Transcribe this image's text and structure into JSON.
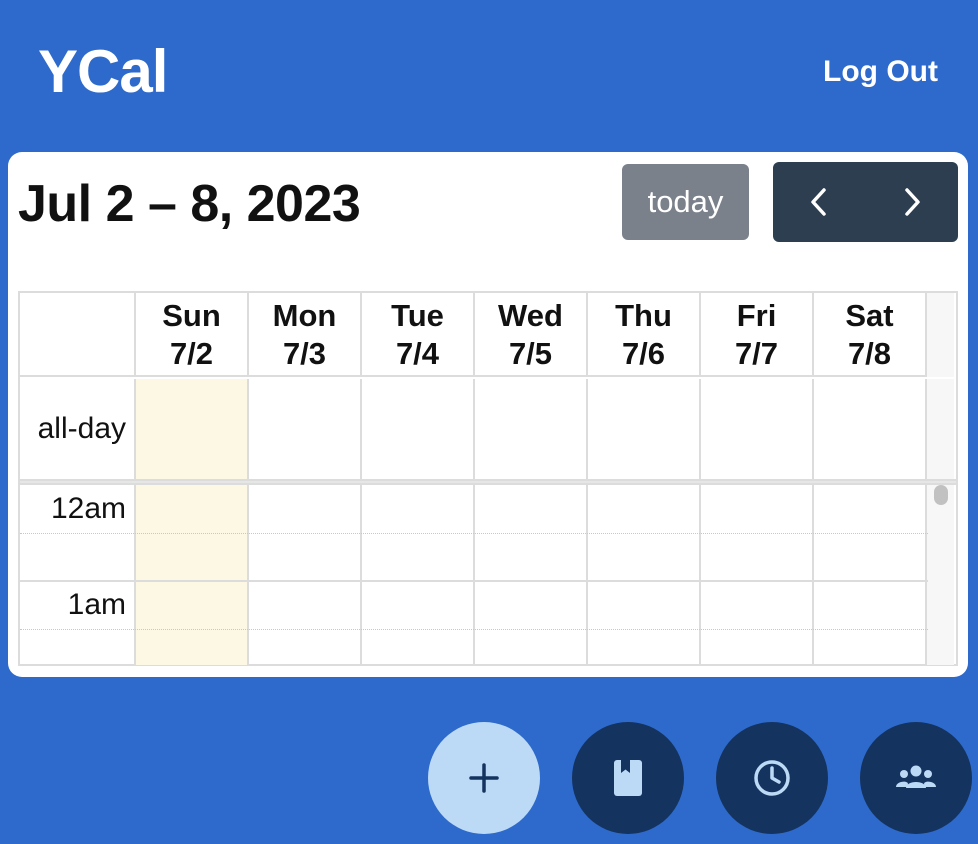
{
  "app": {
    "title": "YCal",
    "logout_label": "Log Out"
  },
  "toolbar": {
    "range_title": "Jul 2 – 8, 2023",
    "today_label": "today",
    "prev_icon": "chevron-left-icon",
    "next_icon": "chevron-right-icon"
  },
  "calendar": {
    "days": [
      {
        "name": "Sun",
        "date": "7/2"
      },
      {
        "name": "Mon",
        "date": "7/3"
      },
      {
        "name": "Tue",
        "date": "7/4"
      },
      {
        "name": "Wed",
        "date": "7/5"
      },
      {
        "name": "Thu",
        "date": "7/6"
      },
      {
        "name": "Fri",
        "date": "7/7"
      },
      {
        "name": "Sat",
        "date": "7/8"
      }
    ],
    "allday_label": "all-day",
    "times": [
      "12am",
      "1am"
    ]
  },
  "fabs": [
    {
      "name": "add-event-button",
      "icon": "plus-icon"
    },
    {
      "name": "book-button",
      "icon": "book-icon"
    },
    {
      "name": "history-button",
      "icon": "clock-icon"
    },
    {
      "name": "groups-button",
      "icon": "users-icon"
    }
  ],
  "colors": {
    "background": "#2e6acb",
    "today_column": "#fdf8e3",
    "today_button": "#7b818b",
    "nav_group": "#2c3e50",
    "fab_add": "#bcdaf5",
    "fab_dark": "#14335f"
  }
}
